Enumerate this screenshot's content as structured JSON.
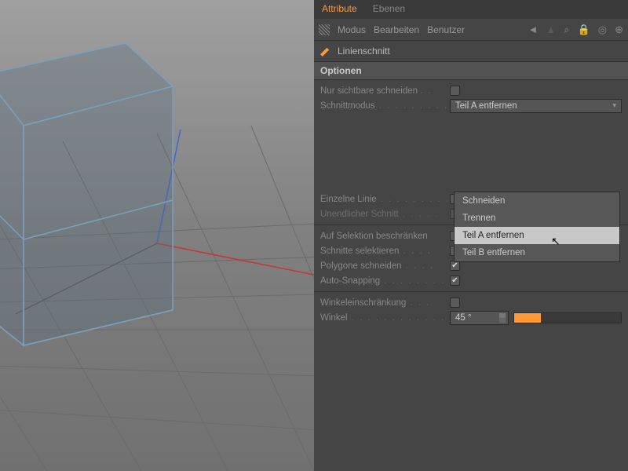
{
  "tabs": {
    "attribute": "Attribute",
    "ebenen": "Ebenen"
  },
  "toolbar": {
    "modus": "Modus",
    "bearbeiten": "Bearbeiten",
    "benutzer": "Benutzer"
  },
  "tool": {
    "name": "Linienschnitt"
  },
  "section": {
    "optionen": "Optionen"
  },
  "options": {
    "nur_sichtbare": "Nur sichtbare schneiden",
    "schnittmodus": "Schnittmodus",
    "schnittmodus_value": "Teil A entfernen",
    "einzelne_linie": "Einzelne Linie",
    "unendlicher_schnitt": "Unendlicher Schnitt",
    "auf_selektion": "Auf Selektion beschränken",
    "schnitte_selektieren": "Schnitte selektieren",
    "polygone_schneiden": "Polygone schneiden",
    "auto_snapping": "Auto-Snapping",
    "winkeleinschraenkung": "Winkeleinschränkung",
    "winkel": "Winkel",
    "winkel_value": "45 °"
  },
  "dropdown_items": {
    "schneiden": "Schneiden",
    "trennen": "Trennen",
    "teil_a": "Teil A entfernen",
    "teil_b": "Teil B entfernen"
  }
}
